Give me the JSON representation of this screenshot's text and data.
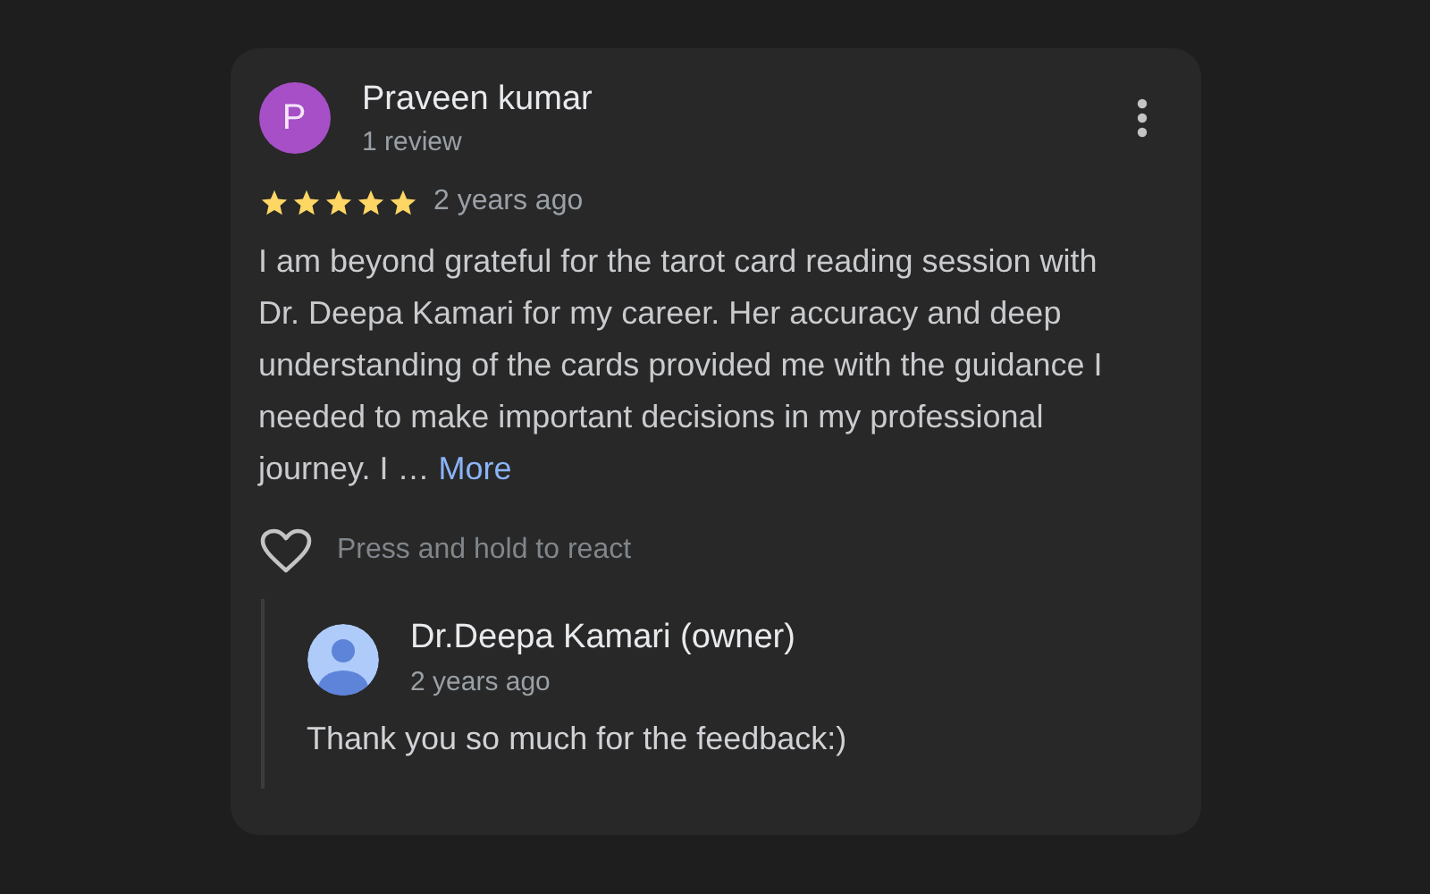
{
  "review": {
    "avatar_letter": "P",
    "author": "Praveen kumar",
    "meta": "1 review",
    "stars": 5,
    "time": "2 years ago",
    "text": "I am beyond grateful for the tarot card reading session with Dr. Deepa Kamari for my career. Her accuracy and deep understanding of the cards provided me with the guidance I needed to make important decisions in my professional journey. I …",
    "more_link": "More",
    "react_label": "Press and hold to react"
  },
  "reply": {
    "author": "Dr.Deepa Kamari (owner)",
    "time": "2 years ago",
    "text": "Thank you so much for the feedback:)"
  }
}
